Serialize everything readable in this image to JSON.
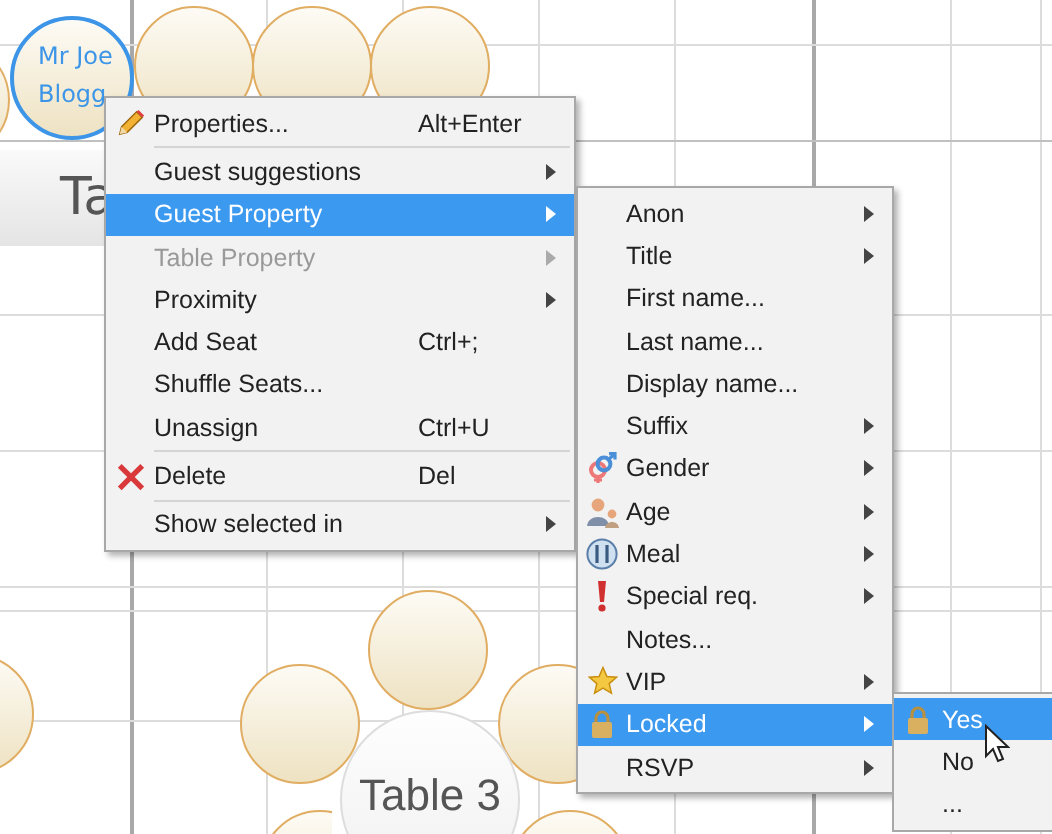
{
  "canvas": {
    "selected_seat": {
      "name": "Mr Joe Blogg",
      "selected": true
    },
    "table_labels": [
      "Ta",
      "Table 3"
    ]
  },
  "context_menu": {
    "items": [
      {
        "kind": "item",
        "label": "Properties...",
        "shortcut": "Alt+Enter",
        "has_submenu": false,
        "selected": false,
        "disabled": false
      },
      {
        "kind": "separator"
      },
      {
        "kind": "item",
        "label": "Guest suggestions",
        "has_submenu": true,
        "selected": false,
        "disabled": false
      },
      {
        "kind": "item",
        "label": "Guest Property",
        "has_submenu": true,
        "selected": true,
        "disabled": false
      },
      {
        "kind": "item",
        "label": "Table Property",
        "has_submenu": true,
        "selected": false,
        "disabled": true
      },
      {
        "kind": "item",
        "label": "Proximity",
        "has_submenu": true,
        "selected": false,
        "disabled": false
      },
      {
        "kind": "item",
        "label": "Add Seat",
        "shortcut": "Ctrl+;",
        "has_submenu": false,
        "selected": false,
        "disabled": false
      },
      {
        "kind": "item",
        "label": "Shuffle Seats...",
        "has_submenu": false,
        "selected": false,
        "disabled": false
      },
      {
        "kind": "item",
        "label": "Unassign",
        "shortcut": "Ctrl+U",
        "has_submenu": false,
        "selected": false,
        "disabled": false
      },
      {
        "kind": "separator"
      },
      {
        "kind": "item",
        "label": "Delete",
        "shortcut": "Del",
        "has_submenu": false,
        "selected": false,
        "disabled": false
      },
      {
        "kind": "separator"
      },
      {
        "kind": "item",
        "label": "Show selected in",
        "has_submenu": true,
        "selected": false,
        "disabled": false
      }
    ]
  },
  "guest_property_menu": {
    "items": [
      {
        "label": "Anon",
        "has_submenu": true,
        "selected": false
      },
      {
        "label": "Title",
        "has_submenu": true,
        "selected": false
      },
      {
        "label": "First name...",
        "has_submenu": false,
        "selected": false
      },
      {
        "label": "Last name...",
        "has_submenu": false,
        "selected": false
      },
      {
        "label": "Display name...",
        "has_submenu": false,
        "selected": false
      },
      {
        "label": "Suffix",
        "has_submenu": true,
        "selected": false
      },
      {
        "label": "Gender",
        "has_submenu": true,
        "selected": false
      },
      {
        "label": "Age",
        "has_submenu": true,
        "selected": false
      },
      {
        "label": "Meal",
        "has_submenu": true,
        "selected": false
      },
      {
        "label": "Special req.",
        "has_submenu": true,
        "selected": false
      },
      {
        "label": "Notes...",
        "has_submenu": false,
        "selected": false
      },
      {
        "label": "VIP",
        "has_submenu": true,
        "selected": false
      },
      {
        "label": "Locked",
        "has_submenu": true,
        "selected": true
      },
      {
        "label": "RSVP",
        "has_submenu": true,
        "selected": false
      }
    ]
  },
  "locked_menu": {
    "items": [
      {
        "label": "Yes",
        "selected": true
      },
      {
        "label": "No",
        "selected": false
      },
      {
        "label": "...",
        "selected": false
      }
    ]
  }
}
